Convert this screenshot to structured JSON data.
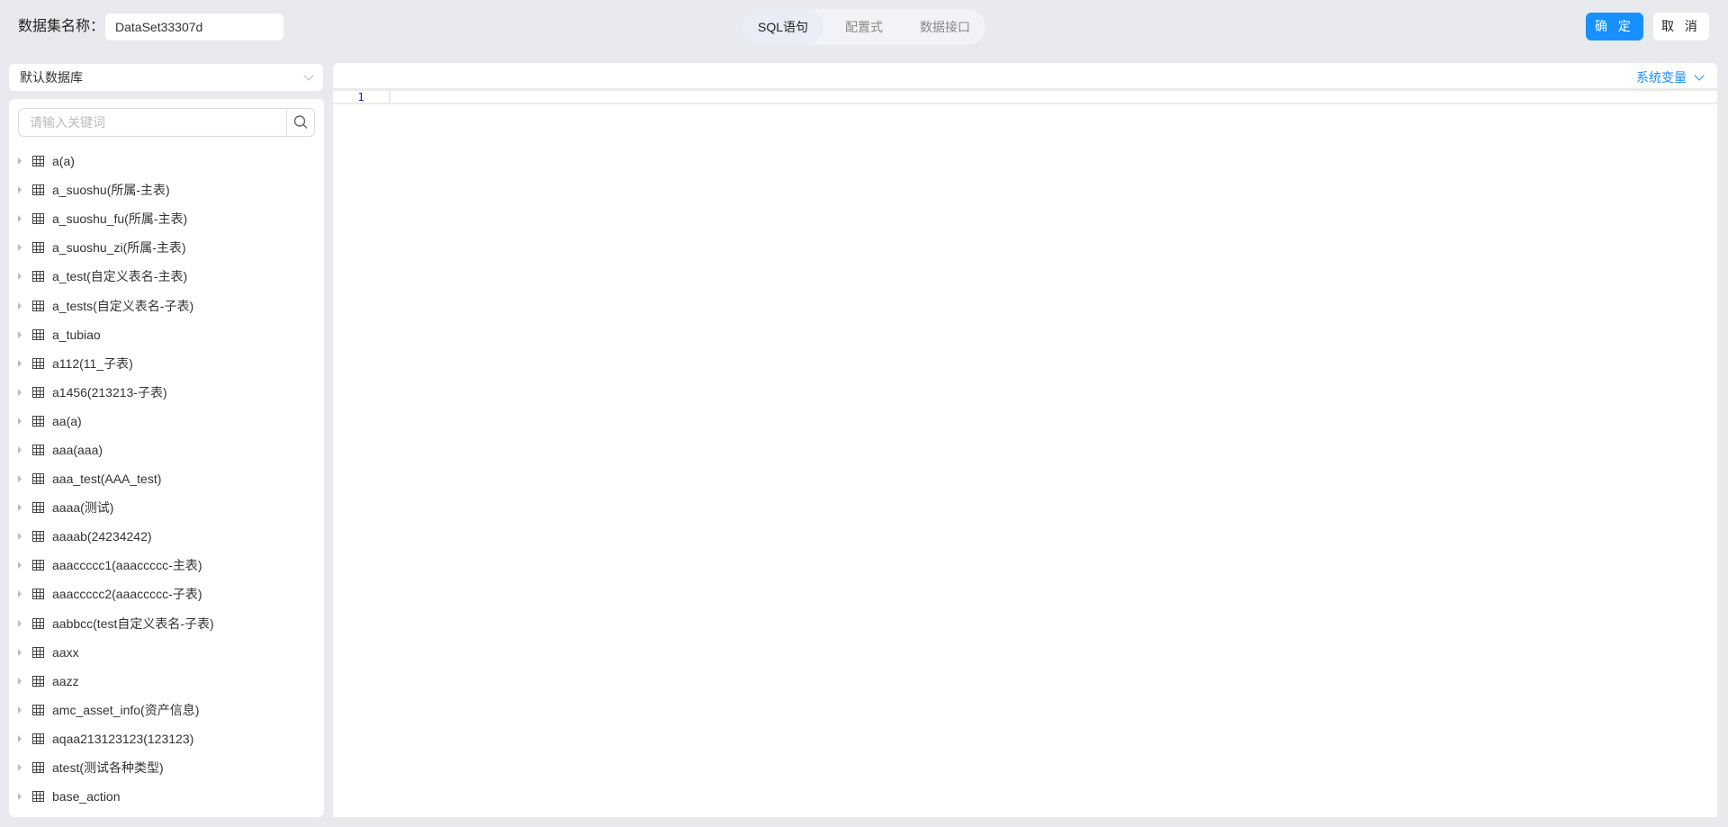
{
  "header": {
    "name_label": "数据集名称：",
    "name_value": "DataSet33307d",
    "tabs": [
      {
        "label": "SQL语句",
        "active": true
      },
      {
        "label": "配置式",
        "active": false
      },
      {
        "label": "数据接口",
        "active": false
      }
    ],
    "confirm_label": "确 定",
    "cancel_label": "取 消"
  },
  "sidebar": {
    "database": "默认数据库",
    "search_placeholder": "请输入关键词",
    "tables": [
      "a(a)",
      "a_suoshu(所属-主表)",
      "a_suoshu_fu(所属-主表)",
      "a_suoshu_zi(所属-主表)",
      "a_test(自定义表名-主表)",
      "a_tests(自定义表名-子表)",
      "a_tubiao",
      "a112(11_子表)",
      "a1456(213213-子表)",
      "aa(a)",
      "aaa(aaa)",
      "aaa_test(AAA_test)",
      "aaaa(测试)",
      "aaaab(24234242)",
      "aaaccccc1(aaaccccc-主表)",
      "aaaccccc2(aaaccccc-子表)",
      "aabbcc(test自定义表名-子表)",
      "aaxx",
      "aazz",
      "amc_asset_info(资产信息)",
      "aqaa213123123(123123)",
      "atest(测试各种类型)",
      "base_action"
    ]
  },
  "editor": {
    "system_vars_label": "系统变量",
    "line_numbers": [
      "1"
    ],
    "content": ""
  },
  "colors": {
    "accent": "#1890ff",
    "background": "#e9eaee"
  }
}
